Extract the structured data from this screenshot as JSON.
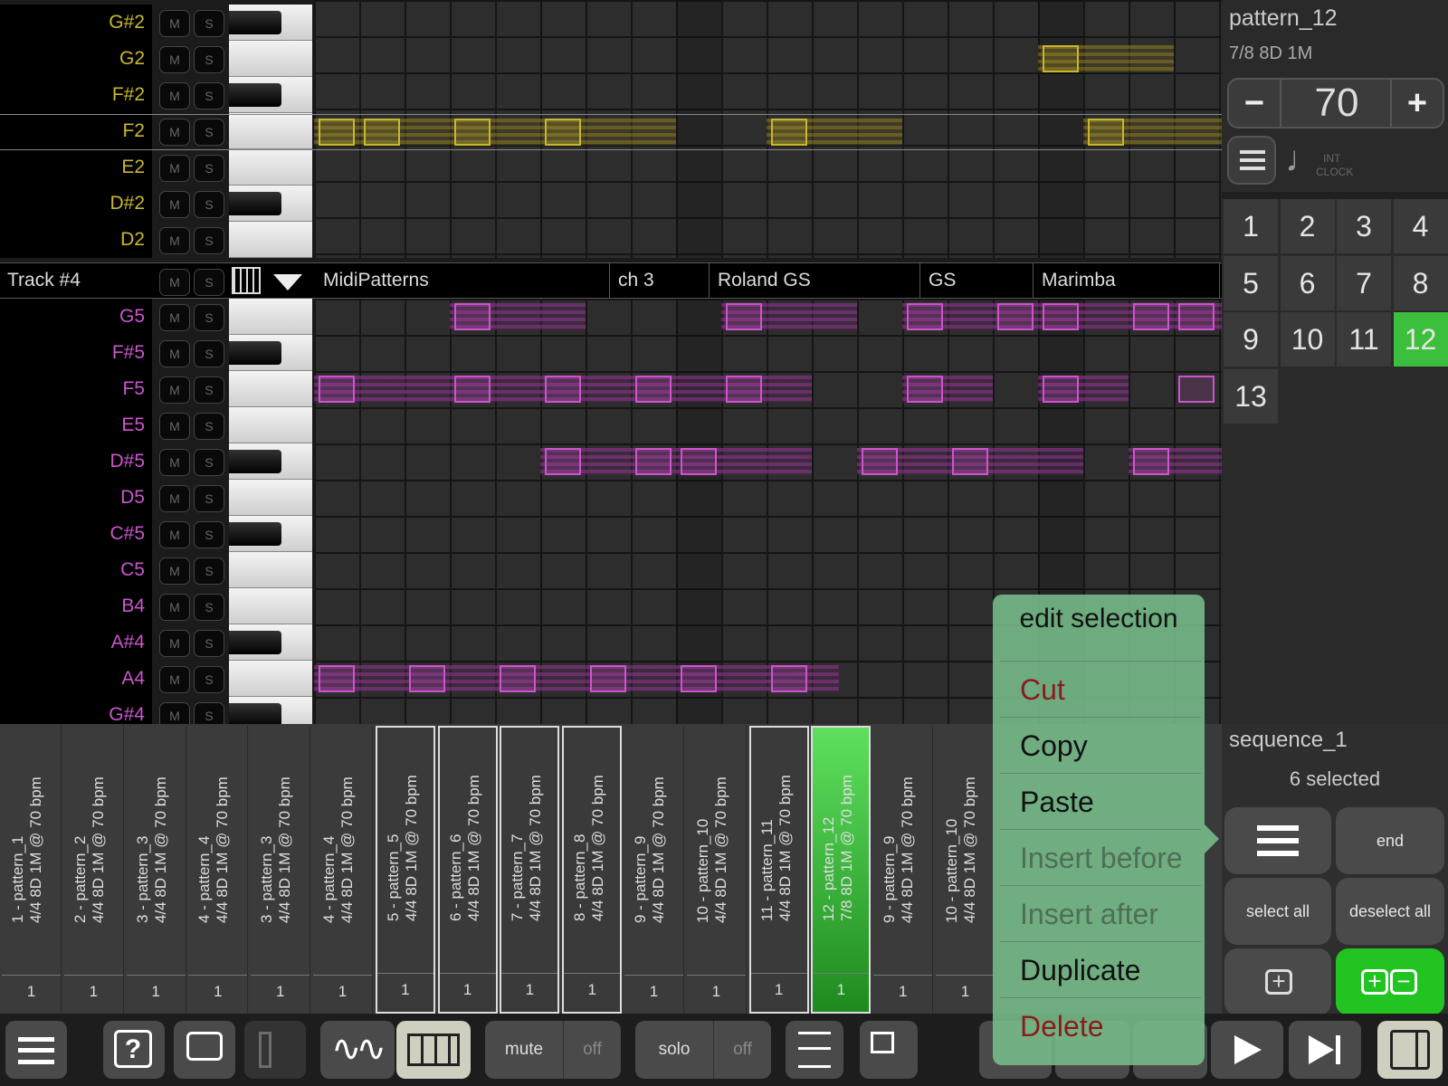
{
  "upper_rows": [
    {
      "note": "G#2",
      "mute": "M",
      "solo": "S"
    },
    {
      "note": "G2",
      "mute": "M",
      "solo": "S"
    },
    {
      "note": "F#2",
      "mute": "M",
      "solo": "S"
    },
    {
      "note": "F2",
      "mute": "M",
      "solo": "S"
    },
    {
      "note": "E2",
      "mute": "M",
      "solo": "S"
    },
    {
      "note": "D#2",
      "mute": "M",
      "solo": "S"
    },
    {
      "note": "D2",
      "mute": "M",
      "solo": "S"
    }
  ],
  "track": {
    "name": "Track #4",
    "mute": "M",
    "solo": "S",
    "patterns": "MidiPatterns",
    "channel": "ch 3",
    "bank": "Roland GS",
    "gs": "GS",
    "instrument": "Marimba"
  },
  "lower_rows": [
    {
      "note": "G5",
      "mute": "M",
      "solo": "S"
    },
    {
      "note": "F#5",
      "mute": "M",
      "solo": "S"
    },
    {
      "note": "F5",
      "mute": "M",
      "solo": "S"
    },
    {
      "note": "E5",
      "mute": "M",
      "solo": "S"
    },
    {
      "note": "D#5",
      "mute": "M",
      "solo": "S"
    },
    {
      "note": "D5",
      "mute": "M",
      "solo": "S"
    },
    {
      "note": "C#5",
      "mute": "M",
      "solo": "S"
    },
    {
      "note": "C5",
      "mute": "M",
      "solo": "S"
    },
    {
      "note": "B4",
      "mute": "M",
      "solo": "S"
    },
    {
      "note": "A#4",
      "mute": "M",
      "solo": "S"
    },
    {
      "note": "A4",
      "mute": "M",
      "solo": "S"
    },
    {
      "note": "G#4",
      "mute": "M",
      "solo": "S"
    }
  ],
  "colors": {
    "upper_notes": "#c9b72d",
    "lower_notes": "#cc55cc",
    "active_green": "#3cbf3c",
    "menu_bg": "#78be8c",
    "danger": "#8a1c1c"
  },
  "right_panel": {
    "pattern_name": "pattern_12",
    "pattern_info": "7/8 8D 1M",
    "minus": "−",
    "tempo": "70",
    "plus": "+",
    "int": "INT",
    "clock": "CLOCK",
    "numbers": [
      "1",
      "2",
      "3",
      "4",
      "5",
      "6",
      "7",
      "8",
      "9",
      "10",
      "11",
      "12",
      "13"
    ],
    "active_number": "12"
  },
  "sequence": {
    "name": "sequence_1",
    "selected": "6 selected",
    "end": "end",
    "select_all": "select all",
    "deselect_all": "deselect all"
  },
  "patterns": [
    {
      "name": "1 - pattern_1",
      "info": "4/4 8D 1M @ 70 bpm",
      "count": "1"
    },
    {
      "name": "2 - pattern_2",
      "info": "4/4 8D 1M @ 70 bpm",
      "count": "1"
    },
    {
      "name": "3 - pattern_3",
      "info": "4/4 8D 1M @ 70 bpm",
      "count": "1"
    },
    {
      "name": "4 - pattern_4",
      "info": "4/4 8D 1M @ 70 bpm",
      "count": "1"
    },
    {
      "name": "3 - pattern_3",
      "info": "4/4 8D 1M @ 70 bpm",
      "count": "1"
    },
    {
      "name": "4 - pattern_4",
      "info": "4/4 8D 1M @ 70 bpm",
      "count": "1"
    },
    {
      "name": "5 - pattern_5",
      "info": "4/4 8D 1M @ 70 bpm",
      "count": "1"
    },
    {
      "name": "6 - pattern_6",
      "info": "4/4 8D 1M @ 70 bpm",
      "count": "1"
    },
    {
      "name": "7 - pattern_7",
      "info": "4/4 8D 1M @ 70 bpm",
      "count": "1"
    },
    {
      "name": "8 - pattern_8",
      "info": "4/4 8D 1M @ 70 bpm",
      "count": "1"
    },
    {
      "name": "9 - pattern_9",
      "info": "4/4 8D 1M @ 70 bpm",
      "count": "1"
    },
    {
      "name": "10 - pattern_10",
      "info": "4/4 8D 1M @ 70 bpm",
      "count": "1"
    },
    {
      "name": "11 - pattern_11",
      "info": "4/4 8D 1M @ 70 bpm",
      "count": "1"
    },
    {
      "name": "12 - pattern_12",
      "info": "7/8 8D 1M @ 70 bpm",
      "count": "1"
    },
    {
      "name": "9 - pattern_9",
      "info": "4/4 8D 1M @ 70 bpm",
      "count": "1"
    },
    {
      "name": "10 - pattern_10",
      "info": "4/4 8D 1M @ 70 bpm",
      "count": "1"
    }
  ],
  "menu": {
    "title": "edit selection",
    "cut": "Cut",
    "copy": "Copy",
    "paste": "Paste",
    "insert_before": "Insert before",
    "insert_after": "Insert after",
    "duplicate": "Duplicate",
    "delete": "Delete"
  },
  "toolbar": {
    "mute": "mute",
    "mute_state": "off",
    "solo": "solo",
    "solo_state": "off"
  }
}
